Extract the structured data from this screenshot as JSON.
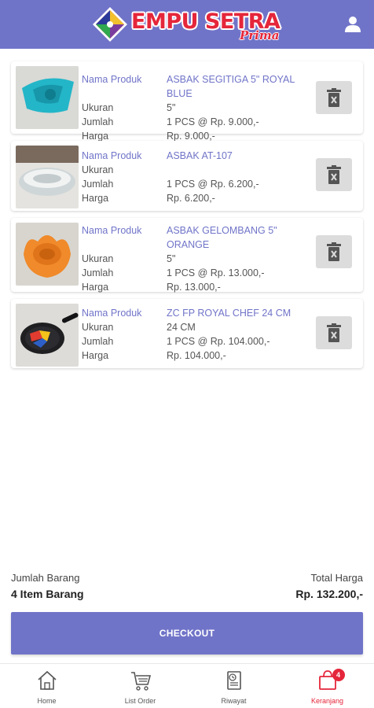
{
  "header": {
    "brand": "EMPU SETRA",
    "brand_sub": "Prima"
  },
  "labels": {
    "name": "Nama Produk",
    "size": "Ukuran",
    "qty": "Jumlah",
    "price": "Harga"
  },
  "items": [
    {
      "name": "ASBAK SEGITIGA 5\" ROYAL BLUE",
      "size": "5\"",
      "qty": "1 PCS @ Rp. 9.000,-",
      "price": "Rp. 9.000,-",
      "image": "teal-triangle-ashtray"
    },
    {
      "name": "ASBAK AT-107",
      "size": "",
      "qty": "1 PCS @ Rp. 6.200,-",
      "price": "Rp. 6.200,-",
      "image": "glass-ashtray"
    },
    {
      "name": "ASBAK GELOMBANG 5\" ORANGE",
      "size": "5\"",
      "qty": "1 PCS @ Rp. 13.000,-",
      "price": "Rp. 13.000,-",
      "image": "orange-wave-ashtray"
    },
    {
      "name": "ZC FP ROYAL CHEF 24 CM",
      "size": "24 CM",
      "qty": "1 PCS @ Rp. 104.000,-",
      "price": "Rp. 104.000,-",
      "image": "frying-pan"
    }
  ],
  "summary": {
    "count_label": "Jumlah Barang",
    "count_value": "4 Item Barang",
    "total_label": "Total Harga",
    "total_value": "Rp. 132.200,-"
  },
  "checkout_label": "CHECKOUT",
  "nav": [
    {
      "label": "Home",
      "icon": "home-icon"
    },
    {
      "label": "List Order",
      "icon": "cart-icon"
    },
    {
      "label": "Riwayat",
      "icon": "history-icon"
    },
    {
      "label": "Keranjang",
      "icon": "bag-icon",
      "badge": "4",
      "active": true
    }
  ],
  "colors": {
    "primary": "#7074c8",
    "accent": "#e5263a"
  }
}
